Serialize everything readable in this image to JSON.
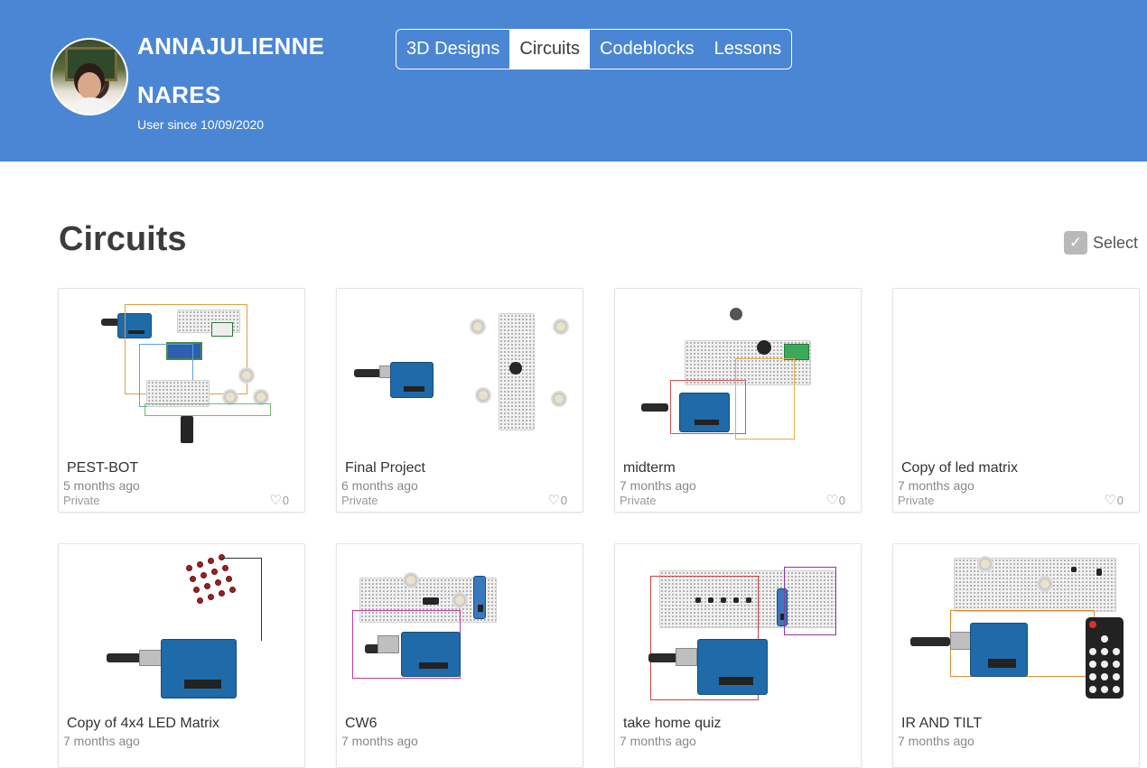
{
  "header": {
    "username": "ANNAJULIENNE NARES",
    "user_since": "User since 10/09/2020",
    "tabs": [
      {
        "label": "3D Designs",
        "active": false
      },
      {
        "label": "Circuits",
        "active": true
      },
      {
        "label": "Codeblocks",
        "active": false
      },
      {
        "label": "Lessons",
        "active": false
      }
    ],
    "colors": {
      "bar": "#4a86d4",
      "text": "#ffffff"
    }
  },
  "main": {
    "title": "Circuits",
    "select_label": "Select",
    "cards": [
      {
        "title": "PEST-BOT",
        "date": "5 months ago",
        "privacy": "Private",
        "likes": "0"
      },
      {
        "title": "Final Project",
        "date": "6 months ago",
        "privacy": "Private",
        "likes": "0"
      },
      {
        "title": "midterm",
        "date": "7 months ago",
        "privacy": "Private",
        "likes": "0"
      },
      {
        "title": "Copy of led matrix",
        "date": "7 months ago",
        "privacy": "Private",
        "likes": "0"
      },
      {
        "title": "Copy of 4x4 LED Matrix",
        "date": "7 months ago",
        "privacy": "",
        "likes": ""
      },
      {
        "title": "CW6",
        "date": "7 months ago",
        "privacy": "",
        "likes": ""
      },
      {
        "title": "take home quiz",
        "date": "7 months ago",
        "privacy": "",
        "likes": ""
      },
      {
        "title": "IR AND TILT",
        "date": "7 months ago",
        "privacy": "",
        "likes": ""
      }
    ]
  },
  "icons": {
    "like": "heart-outline-icon",
    "select": "checkmark-icon"
  }
}
